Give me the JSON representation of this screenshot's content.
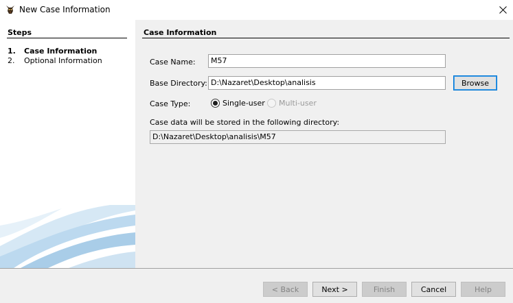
{
  "window": {
    "title": "New Case Information",
    "close_glyph": "✕"
  },
  "steps": {
    "header": "Steps",
    "items": [
      {
        "number": "1.",
        "label": "Case Information"
      },
      {
        "number": "2.",
        "label": "Optional Information"
      }
    ]
  },
  "case_info": {
    "header": "Case Information",
    "case_name_label": "Case Name:",
    "case_name_value": "M57",
    "base_dir_label": "Base Directory:",
    "base_dir_value": "D:\\Nazaret\\Desktop\\analisis",
    "browse_label": "Browse",
    "case_type_label": "Case Type:",
    "single_user_label": "Single-user",
    "multi_user_label": "Multi-user",
    "selected_case_type": "Single-user",
    "storage_label": "Case data will be stored in the following directory:",
    "storage_value": "D:\\Nazaret\\Desktop\\analisis\\M57"
  },
  "buttons": {
    "back": "< Back",
    "next": "Next >",
    "finish": "Finish",
    "cancel": "Cancel",
    "help": "Help"
  },
  "colors": {
    "panel_bg": "#f0f0f0",
    "focus_border": "#0078d7",
    "wave_blue": "#a9cde8"
  },
  "icons": {
    "app": "autopsy-dog-icon",
    "close": "close-icon"
  }
}
